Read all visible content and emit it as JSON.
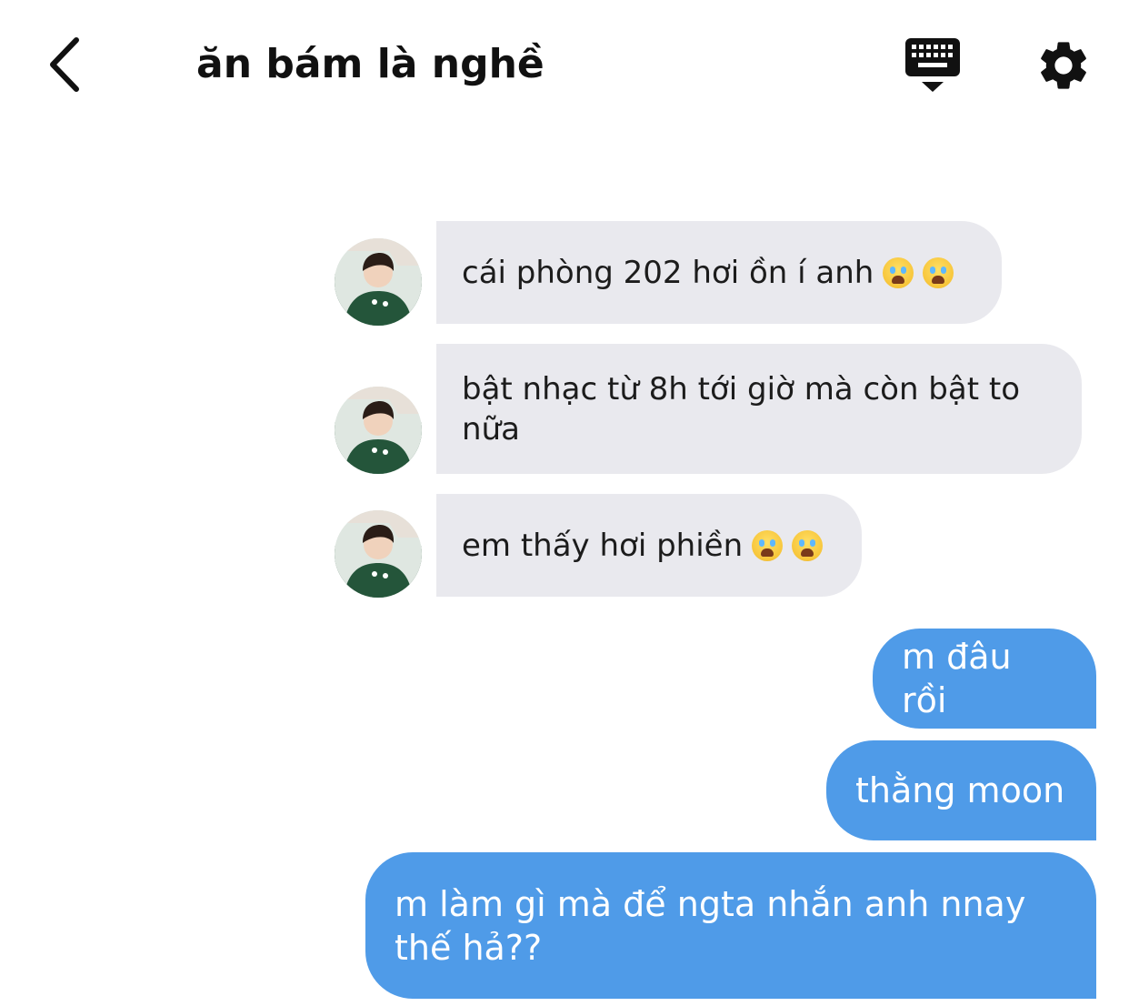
{
  "header": {
    "title": "ăn bám là nghề",
    "back_icon": "chevron-left-icon",
    "keyboard_icon": "keyboard-hide-icon",
    "settings_icon": "gear-icon"
  },
  "messages_in": [
    {
      "text": "cái phòng 202 hơi ồn í anh",
      "emoji": [
        "loudly-crying-face",
        "loudly-crying-face"
      ]
    },
    {
      "text": "bật nhạc từ 8h tới giờ mà còn bật to nữa",
      "emoji": []
    },
    {
      "text": "em thấy hơi phiền",
      "emoji": [
        "loudly-crying-face",
        "loudly-crying-face"
      ]
    }
  ],
  "messages_out": [
    {
      "text": "m đâu rồi"
    },
    {
      "text": "thằng moon"
    },
    {
      "text": "m làm gì mà để ngta nhắn anh nnay thế hả??"
    }
  ],
  "colors": {
    "incoming_bubble": "#e9e9ee",
    "outgoing_bubble": "#4f9be8",
    "outgoing_text": "#ffffff"
  }
}
